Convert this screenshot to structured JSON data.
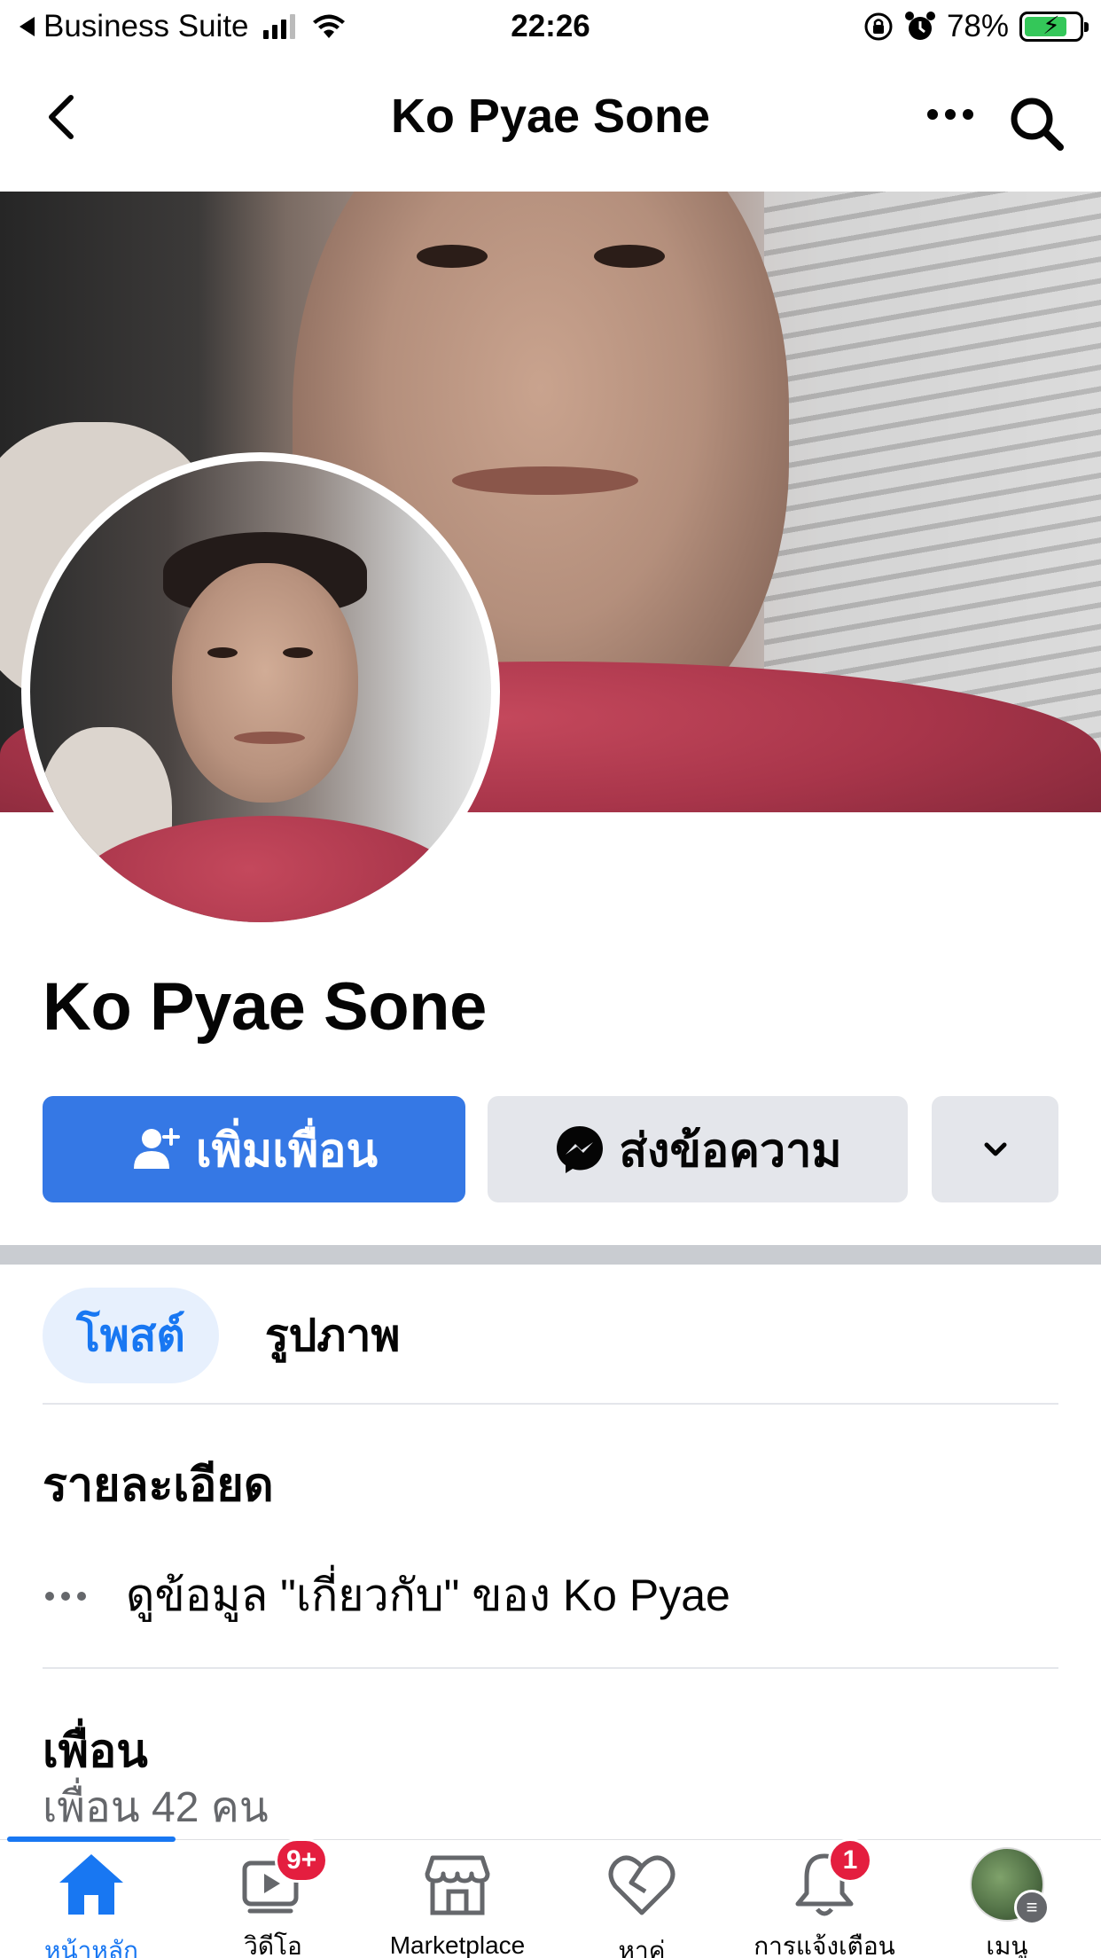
{
  "status_bar": {
    "back_app": "Business Suite",
    "time": "22:26",
    "battery": "78%",
    "battery_level": 0.78
  },
  "nav": {
    "title": "Ko Pyae Sone"
  },
  "profile": {
    "name": "Ko Pyae Sone"
  },
  "actions": {
    "add_friend": "เพิ่มเพื่อน",
    "message": "ส่งข้อความ"
  },
  "tabs": [
    {
      "label": "โพสต์",
      "active": true
    },
    {
      "label": "รูปภาพ",
      "active": false
    }
  ],
  "details": {
    "title": "รายละเอียด",
    "about_text": "ดูข้อมูล \"เกี่ยวกับ\" ของ Ko Pyae"
  },
  "friends": {
    "title": "เพื่อน",
    "count_text": "เพื่อน 42 คน"
  },
  "tabbar": {
    "items": [
      {
        "label": "หน้าหลัก",
        "icon": "home-icon",
        "active": true
      },
      {
        "label": "วิดีโอ",
        "icon": "video-icon",
        "badge": "9+"
      },
      {
        "label": "Marketplace",
        "icon": "marketplace-icon"
      },
      {
        "label": "หาคู่",
        "icon": "dating-icon"
      },
      {
        "label": "การแจ้งเตือน",
        "icon": "bell-icon",
        "badge": "1"
      },
      {
        "label": "เมนู",
        "icon": "menu-avatar"
      }
    ]
  },
  "colors": {
    "accent": "#1877f2",
    "button_primary": "#3578e5",
    "button_secondary": "#e4e6eb",
    "badge": "#e41e3f"
  }
}
